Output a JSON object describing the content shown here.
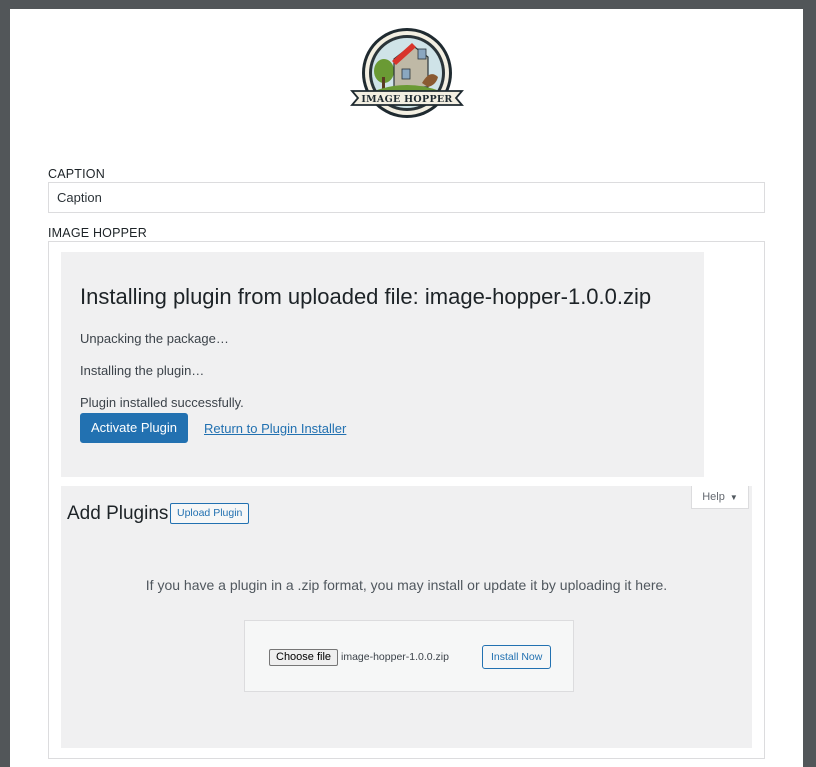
{
  "logo": {
    "text": "IMAGE HOPPER"
  },
  "fields": {
    "caption": {
      "label": "CAPTION",
      "value": "Caption"
    },
    "hopper": {
      "label": "IMAGE HOPPER"
    }
  },
  "install": {
    "title": "Installing plugin from uploaded file: image-hopper-1.0.0.zip",
    "steps": [
      "Unpacking the package…",
      "Installing the plugin…",
      "Plugin installed successfully."
    ],
    "activate_label": "Activate Plugin",
    "return_label": "Return to Plugin Installer"
  },
  "add_plugins": {
    "title": "Add Plugins",
    "upload_label": "Upload Plugin",
    "help_label": "Help",
    "help_text": "If you have a plugin in a .zip format, you may install or update it by uploading it here.",
    "choose_file_label": "Choose file",
    "file_name": "image-hopper-1.0.0.zip",
    "install_label": "Install Now"
  },
  "colors": {
    "accent": "#2271b1",
    "panel_bg": "#f0f0f1",
    "border": "#dcdcde",
    "logo_red": "#d9342b",
    "logo_green": "#6a9a34"
  }
}
